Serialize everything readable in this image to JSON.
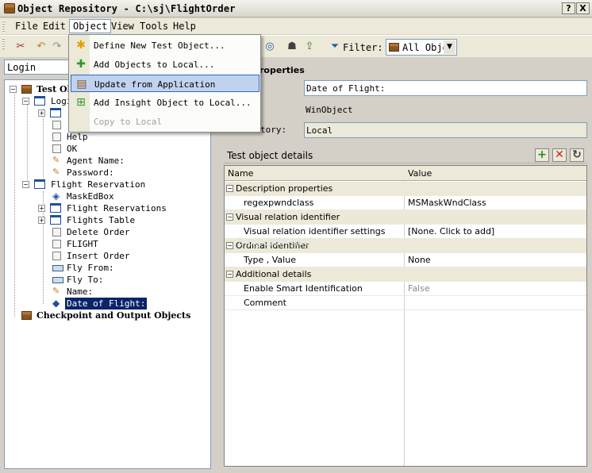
{
  "window": {
    "title": "Object Repository - C:\\sj\\FlightOrder",
    "help_btn": "?",
    "close_btn": "X"
  },
  "menubar": {
    "items": [
      "File",
      "Edit",
      "Object",
      "View",
      "Tools",
      "Help"
    ]
  },
  "object_menu": {
    "items": [
      {
        "label": "Define New Test Object...",
        "icon": "asterisk-icon",
        "disabled": false
      },
      {
        "label": "Add Objects to Local...",
        "icon": "plus-icon",
        "disabled": false
      },
      {
        "label": "Update from Application",
        "icon": "repository-update-icon",
        "disabled": false
      },
      {
        "label": "Add Insight Object to Local...",
        "icon": "insight-plus-icon",
        "disabled": false
      },
      {
        "label": "Copy to Local",
        "icon": "",
        "disabled": true
      }
    ]
  },
  "toolbar": {
    "filter_label": "Filter:",
    "filter_value": "All Obje"
  },
  "left_combo": {
    "value": "Login"
  },
  "tree": {
    "root": "Test Ob",
    "login": "Logi",
    "items": [
      {
        "label": "Help",
        "icon": "checkbox-icon"
      },
      {
        "label": "OK",
        "icon": "checkbox-icon"
      },
      {
        "label": "Agent Name:",
        "icon": "pencil-icon"
      },
      {
        "label": "Password:",
        "icon": "pencil-icon"
      }
    ],
    "flight_reservation": "Flight Reservation",
    "fr_items": [
      {
        "label": "MaskEdBox",
        "icon": "combo-icon"
      },
      {
        "label": "Flight Reservations",
        "icon": "window-icon"
      },
      {
        "label": "Flights Table",
        "icon": "window-icon"
      },
      {
        "label": "Delete Order",
        "icon": "checkbox-icon"
      },
      {
        "label": "FLIGHT",
        "icon": "checkbox-icon"
      },
      {
        "label": "Insert Order",
        "icon": "checkbox-icon"
      },
      {
        "label": "Fly From:",
        "icon": "edit-icon"
      },
      {
        "label": "Fly To:",
        "icon": "edit-icon"
      },
      {
        "label": "Name:",
        "icon": "pencil-icon"
      },
      {
        "label": "Date of Flight:",
        "icon": "combo-icon"
      }
    ],
    "checkpoint": "Checkpoint and Output Objects"
  },
  "properties": {
    "heading": "roperties",
    "name_value": "Date of Flight:",
    "class_value": "WinObject",
    "repository_label": "tory:",
    "repository_value": "Local"
  },
  "details": {
    "title": "Test object details",
    "col_name": "Name",
    "col_value": "Value",
    "rows": [
      {
        "cat": true,
        "name": "Description properties",
        "value": ""
      },
      {
        "cat": false,
        "name": "regexpwndclass",
        "value": "MSMaskWndClass"
      },
      {
        "cat": true,
        "name": "Visual relation identifier",
        "value": ""
      },
      {
        "cat": false,
        "name": "Visual relation identifier settings",
        "value": "[None. Click to add]"
      },
      {
        "cat": true,
        "name": "Ordinal identifier",
        "value": ""
      },
      {
        "cat": false,
        "name": "Type , Value",
        "value": "None"
      },
      {
        "cat": true,
        "name": "Additional details",
        "value": ""
      },
      {
        "cat": false,
        "name": "Enable Smart Identification",
        "value": "False"
      },
      {
        "cat": false,
        "name": "Comment",
        "value": ""
      }
    ]
  },
  "watermark": "blog.csdn.net/"
}
